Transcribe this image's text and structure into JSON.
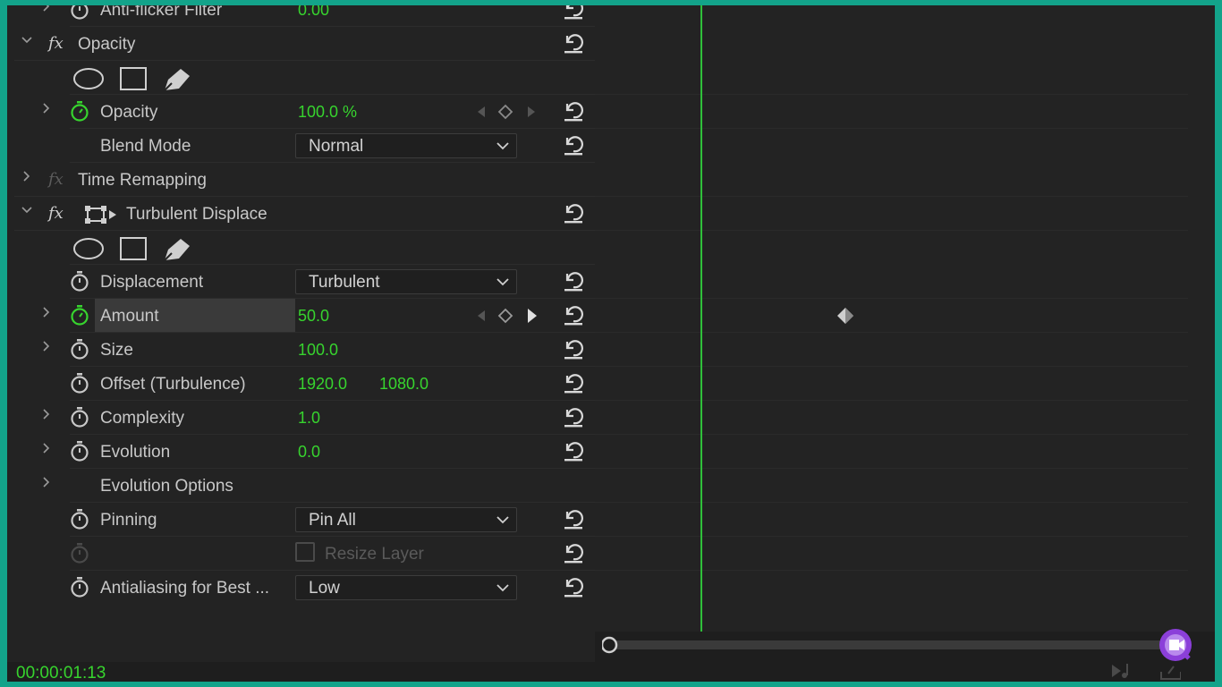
{
  "effects": {
    "top_partial": {
      "label": "Anti-flicker Filter",
      "value": "0.00"
    },
    "opacity_group": {
      "fx": "fx",
      "label": "Opacity"
    },
    "opacity": {
      "label": "Opacity",
      "value": "100.0 %"
    },
    "blend_mode": {
      "label": "Blend Mode",
      "selected": "Normal"
    },
    "time_remapping": {
      "fx": "fx",
      "label": "Time Remapping"
    },
    "turbulent_group": {
      "fx": "fx",
      "label": "Turbulent Displace"
    },
    "displacement": {
      "label": "Displacement",
      "selected": "Turbulent"
    },
    "amount": {
      "label": "Amount",
      "value": "50.0"
    },
    "size": {
      "label": "Size",
      "value": "100.0"
    },
    "offset": {
      "label": "Offset (Turbulence)",
      "x": "1920.0",
      "y": "1080.0"
    },
    "complexity": {
      "label": "Complexity",
      "value": "1.0"
    },
    "evolution": {
      "label": "Evolution",
      "value": "0.0"
    },
    "evolution_options": {
      "label": "Evolution Options"
    },
    "pinning": {
      "label": "Pinning",
      "selected": "Pin All"
    },
    "resize_layer": {
      "label": "Resize Layer"
    },
    "antialiasing": {
      "label": "Antialiasing for Best ...",
      "selected": "Low"
    }
  },
  "timecode": "00:00:01:13",
  "colors": {
    "accent_green": "#37d42e",
    "playhead": "#2fbf3a",
    "border_teal": "#13a38a",
    "logo_purple": "#8b3fd9"
  },
  "icons": [
    "stopwatch-icon",
    "reset-icon",
    "chevron-right-icon",
    "chevron-down-icon",
    "ellipse-mask-icon",
    "rectangle-mask-icon",
    "pen-mask-icon",
    "keyframe-diamond-icon",
    "dropdown-icon",
    "checkbox-icon",
    "logo-icon"
  ]
}
